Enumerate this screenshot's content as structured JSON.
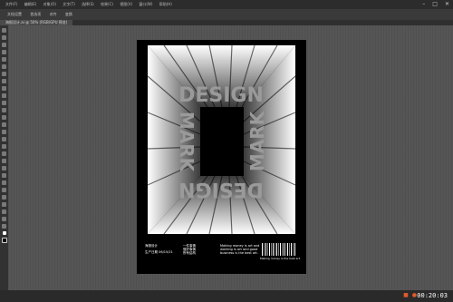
{
  "menubar": {
    "items": [
      "文件(F)",
      "编辑(E)",
      "对象(O)",
      "文字(T)",
      "选择(S)",
      "效果(C)",
      "视图(V)",
      "窗口(W)",
      "帮助(H)"
    ]
  },
  "options_bar": {
    "items": [
      "文档设置",
      "首选项",
      "对齐",
      "变换"
    ]
  },
  "document_tab": {
    "title": "海报设计.ai @ 50% (RGB/GPU 预览)"
  },
  "poster": {
    "words": [
      "DESIGN",
      "MARK"
    ],
    "left_line1": "海报设计",
    "left_line2": "生产日期 06/15/21",
    "mid_lines": [
      "一件事情",
      "做好事情",
      "所有结构"
    ],
    "description": "Making money is art and working is art and good business is the best art.",
    "barcode_caption": "Making money is the best art."
  },
  "status": {
    "clock": "00:20:03"
  },
  "colors": {
    "menubar": "#2c2c2c",
    "canvas": "#525252",
    "artboard": "#000000",
    "accent": "#e05a2b"
  }
}
